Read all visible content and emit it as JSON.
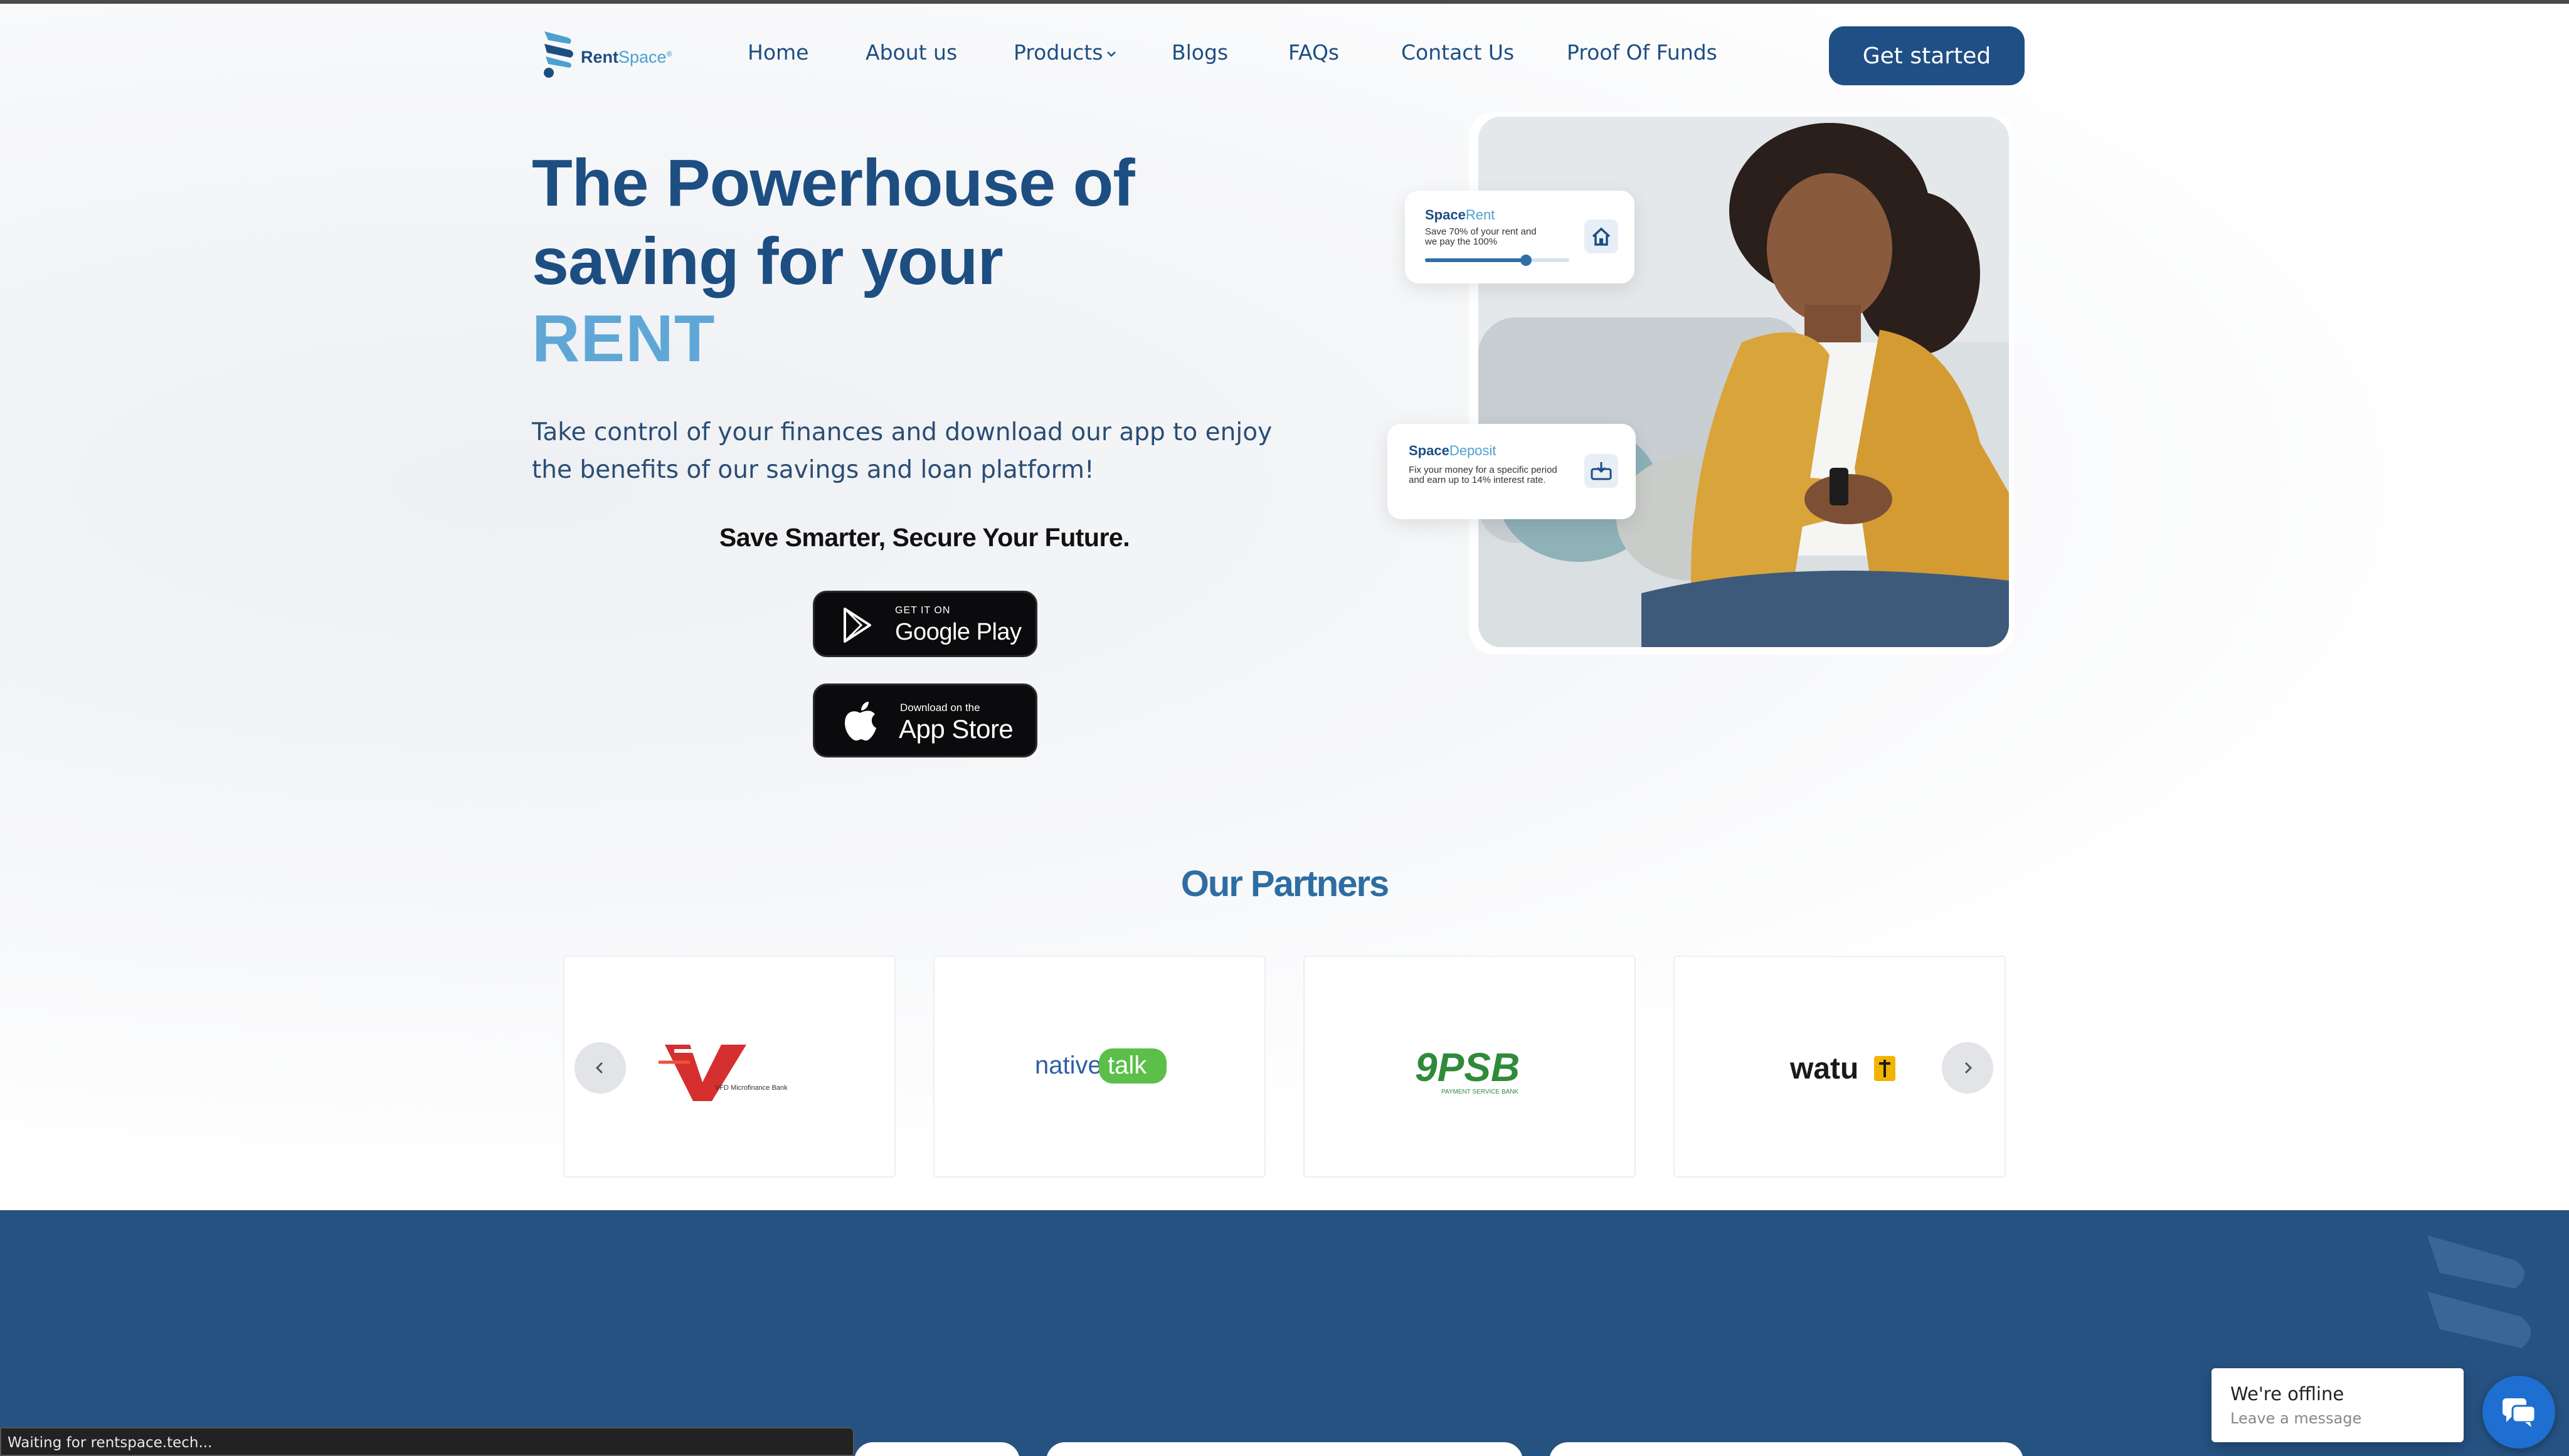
{
  "nav": {
    "logo_text": "Rent",
    "logo_accent": "Space",
    "logo_tm": "®",
    "items": [
      {
        "label": "Home"
      },
      {
        "label": "About us"
      },
      {
        "label": "Products"
      },
      {
        "label": "Blogs"
      },
      {
        "label": "FAQs"
      },
      {
        "label": "Contact Us"
      },
      {
        "label": "Proof Of Funds"
      }
    ],
    "cta_label": "Get started"
  },
  "hero": {
    "title": "The Powerhouse of saving for your",
    "accent": "RENT",
    "description": "Take control of your finances and download our app to enjoy the benefits of our savings and loan platform!",
    "tagline": "Save Smarter, Secure Your Future."
  },
  "store_buttons": {
    "google_small": "GET IT ON",
    "google_big": "Google Play",
    "apple_small": "Download on the",
    "apple_big": "App Store"
  },
  "cards": {
    "rent": {
      "title_prefix": "Space",
      "title_accent": "Rent",
      "text": "Save 70% of your rent and we pay the 100%",
      "progress": 0.7
    },
    "deposit": {
      "title_prefix": "Space",
      "title_accent": "Deposit",
      "text": "Fix your money for a specific period and earn up to 14% interest rate."
    }
  },
  "partners": {
    "title": "Our Partners",
    "items": [
      {
        "name": "VFD Microfinance Bank",
        "mark": "V",
        "color": "#d62f2f"
      },
      {
        "name_a": "native",
        "name_b": "talk"
      },
      {
        "name": "9PSB",
        "sub": "PAYMENT SERVICE BANK"
      },
      {
        "name": "watu"
      }
    ]
  },
  "chat": {
    "title": "We're offline",
    "subtitle": "Leave a message"
  },
  "status": {
    "text": "Waiting for rentspace.tech..."
  },
  "colors": {
    "primary": "#1d4e82",
    "accent": "#5fa7d6",
    "section_blue": "#265282",
    "chat_blue": "#1e6fd1"
  }
}
